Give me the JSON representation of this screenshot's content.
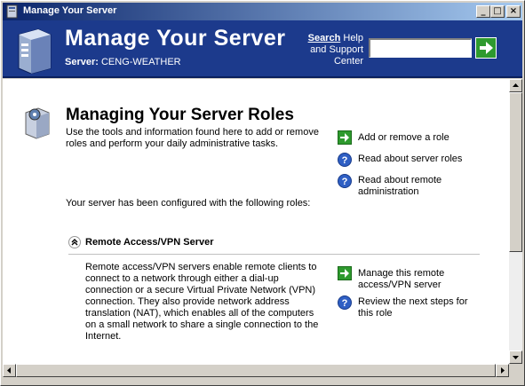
{
  "window": {
    "title": "Manage Your Server"
  },
  "header": {
    "title": "Manage Your Server",
    "server_label": "Server:",
    "server_name": "CENG-WEATHER",
    "search_bold": "Search",
    "search_rest": " Help and Support Center",
    "search_value": ""
  },
  "main": {
    "title": "Managing Your Server Roles",
    "intro": "Use the tools and information found here to add or remove roles and perform your daily administrative tasks.",
    "configured": "Your server has been configured with the following roles:",
    "links": [
      {
        "label": "Add or remove a role",
        "icon": "green-arrow-icon"
      },
      {
        "label": "Read about server roles",
        "icon": "help-icon"
      },
      {
        "label": "Read about remote administration",
        "icon": "help-icon"
      }
    ],
    "role": {
      "title": "Remote Access/VPN Server",
      "description": "Remote access/VPN servers enable remote clients to connect to a network through either a dial-up connection or a secure Virtual Private Network (VPN) connection. They also provide network address translation (NAT), which enables all of the computers on a small network to share a single connection to the Internet.",
      "links": [
        {
          "label": "Manage this remote access/VPN server",
          "icon": "green-arrow-icon"
        },
        {
          "label": "Review the next steps for this role",
          "icon": "help-icon"
        }
      ]
    }
  },
  "colors": {
    "header_bg": "#1c3a8c",
    "title_bar_start": "#0a246a",
    "accent_green": "#2e9a2e"
  }
}
